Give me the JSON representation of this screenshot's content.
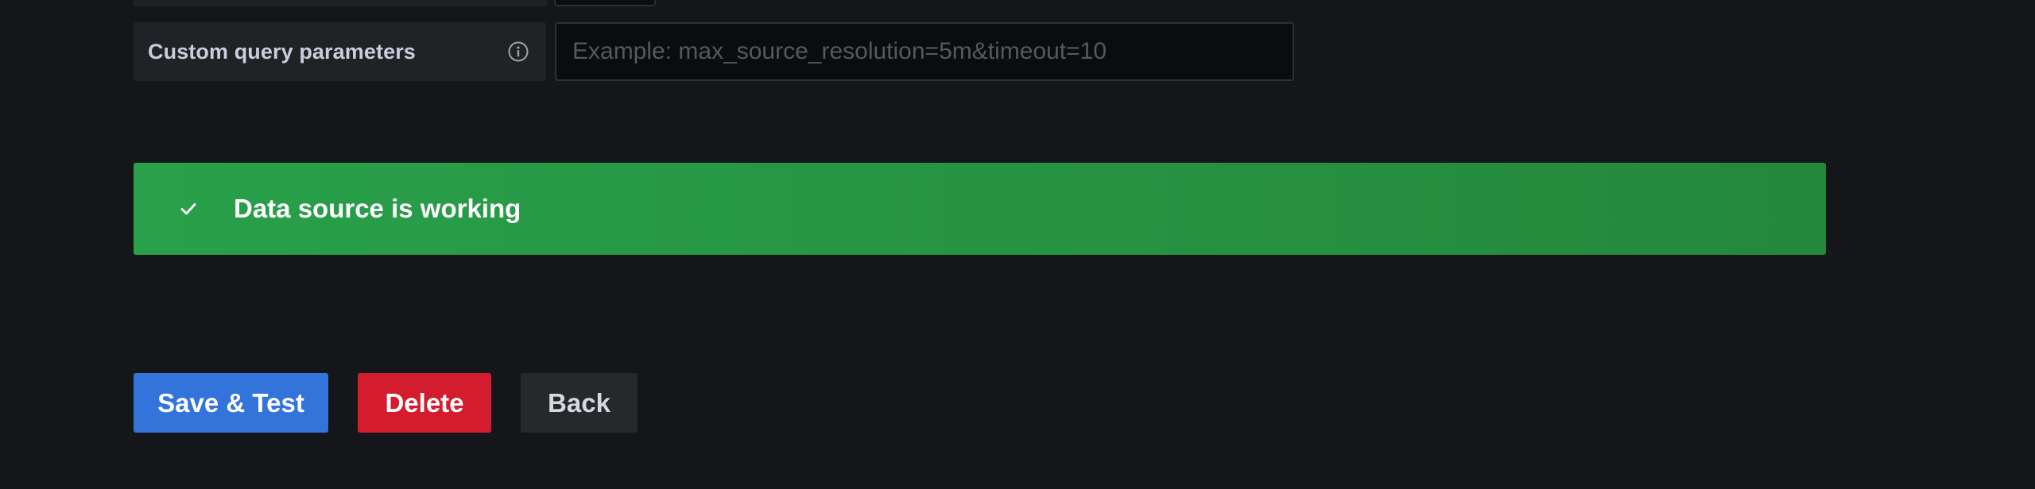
{
  "custom_query": {
    "label": "Custom query parameters",
    "placeholder": "Example: max_source_resolution=5m&timeout=10",
    "value": ""
  },
  "icons": {
    "info": "info-circle-icon",
    "check": "check-icon"
  },
  "alert": {
    "message": "Data source is working",
    "color": "#299c46"
  },
  "actions": {
    "save_label": "Save & Test",
    "delete_label": "Delete",
    "back_label": "Back"
  },
  "colors": {
    "background": "#141619",
    "primary": "#3274d9",
    "destructive": "#d41c2f",
    "secondary": "#26282c",
    "success": "#299c46"
  }
}
